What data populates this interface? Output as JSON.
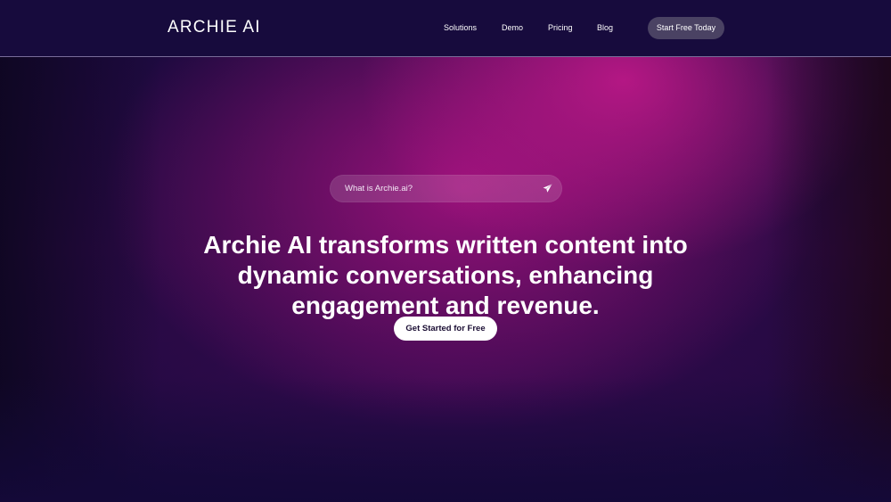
{
  "header": {
    "logo_text": "ARCHIE AI",
    "nav": [
      {
        "label": "Solutions"
      },
      {
        "label": "Demo"
      },
      {
        "label": "Pricing"
      },
      {
        "label": "Blog"
      }
    ],
    "cta_label": "Start Free Today"
  },
  "hero": {
    "search_placeholder": "What is Archie.ai?",
    "search_icon": "send-icon",
    "headline_lines": [
      "Archie AI transforms written content into",
      "dynamic conversations, enhancing",
      "engagement and revenue."
    ],
    "cta_label": "Get Started for Free"
  },
  "colors": {
    "header_bg": "#170b3d",
    "accent_magenta": "#a5127f",
    "nav_button_bg": "#4a4263",
    "cta_bg": "#ffffff",
    "cta_text": "#1a0d33"
  }
}
